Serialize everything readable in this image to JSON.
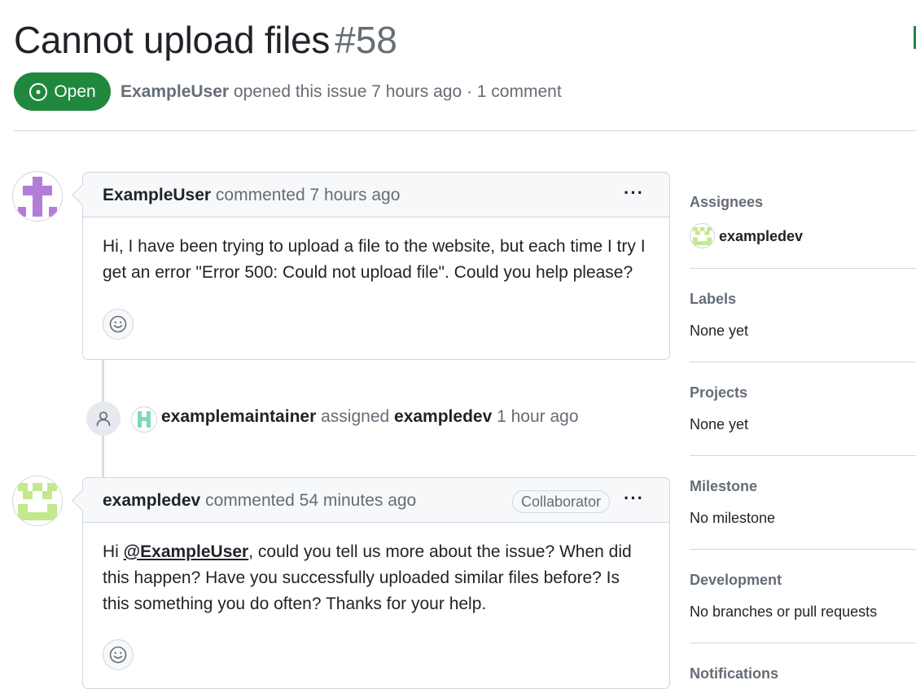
{
  "issue": {
    "title": "Cannot upload files",
    "number": "#58",
    "state": "Open",
    "author": "ExampleUser",
    "opened_text": "opened this issue 7 hours ago · 1 comment"
  },
  "timeline": {
    "comment1": {
      "author": "ExampleUser",
      "action": "commented 7 hours ago",
      "body": "Hi, I have been trying to upload a file to the website, but each time I try I get an error \"Error 500: Could not upload file\". Could you help please?"
    },
    "event": {
      "actor": "examplemaintainer",
      "verb": "assigned",
      "target": "exampledev",
      "time": "1 hour ago"
    },
    "comment2": {
      "author": "exampledev",
      "action": "commented 54 minutes ago",
      "role": "Collaborator",
      "body_prefix": "Hi ",
      "mention": "@ExampleUser",
      "body_rest": ", could you tell us more about the issue? When did this happen? Have you successfully uploaded similar files before? Is this something you do often? Thanks for your help."
    },
    "more_label": "···"
  },
  "sidebar": {
    "assignees": {
      "heading": "Assignees",
      "user": "exampledev"
    },
    "labels": {
      "heading": "Labels",
      "value": "None yet"
    },
    "projects": {
      "heading": "Projects",
      "value": "None yet"
    },
    "milestone": {
      "heading": "Milestone",
      "value": "No milestone"
    },
    "development": {
      "heading": "Development",
      "value": "No branches or pull requests"
    },
    "notifications": {
      "heading": "Notifications"
    }
  },
  "colors": {
    "open_green": "#1f883d",
    "muted": "#656d76",
    "avatar_purple": "#b27ed9",
    "avatar_lime": "#c3e88d",
    "avatar_teal": "#7fd9b3"
  }
}
